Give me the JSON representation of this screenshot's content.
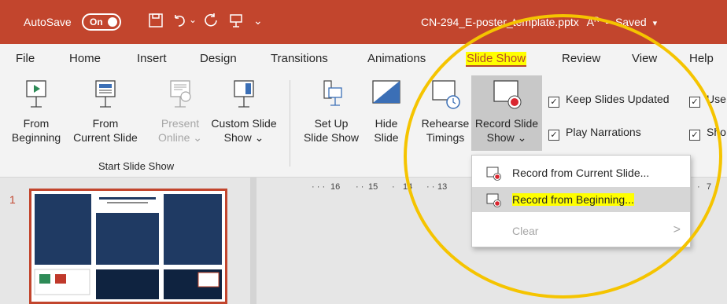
{
  "titlebar": {
    "autosave_label": "AutoSave",
    "autosave_state": "On",
    "document_title": "CN-294_E-poster_template.pptx",
    "saved_status": "Saved",
    "accent_color": "#c2452d"
  },
  "tabs": [
    "File",
    "Home",
    "Insert",
    "Design",
    "Transitions",
    "Animations",
    "Slide Show",
    "Review",
    "View",
    "Help"
  ],
  "active_tab": "Slide Show",
  "ribbon": {
    "start_group_label": "Start Slide Show",
    "from_beginning": [
      "From",
      "Beginning"
    ],
    "from_current": [
      "From",
      "Current Slide"
    ],
    "present_online": [
      "Present",
      "Online ⌄"
    ],
    "custom_show": [
      "Custom Slide",
      "Show ⌄"
    ],
    "set_up": [
      "Set Up",
      "Slide Show"
    ],
    "hide_slide": [
      "Hide",
      "Slide"
    ],
    "rehearse": [
      "Rehearse",
      "Timings"
    ],
    "record_show": [
      "Record Slide",
      "Show ⌄"
    ],
    "keep_updated": "Keep Slides Updated",
    "play_narrations": "Play Narrations",
    "use_label": "Use",
    "show_label": "Sho"
  },
  "menu": {
    "items": [
      {
        "label": "Record from Current Slide...",
        "icon": "record-icon",
        "enabled": true
      },
      {
        "label": "Record from Beginning...",
        "icon": "record-icon",
        "enabled": true,
        "highlighted": true
      },
      {
        "label": "Clear",
        "icon": "",
        "enabled": false
      }
    ]
  },
  "ruler": [
    "16",
    "15",
    "14",
    "13",
    "7"
  ],
  "slide_number": "1"
}
